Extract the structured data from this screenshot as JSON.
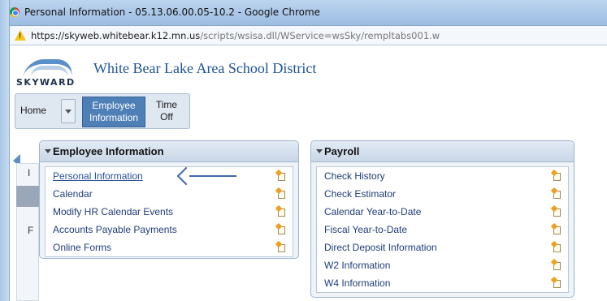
{
  "window": {
    "title": "Personal Information - 05.13.06.00.05-10.2 - Google Chrome"
  },
  "address_bar": {
    "url_host": "https://skyweb.whitebear.k12.mn.us",
    "url_path": "/scripts/wsisa.dll/WService=wsSky/rempltabs001.w"
  },
  "header": {
    "logo_text": "SKYWARD",
    "district_name": "White Bear Lake Area School District"
  },
  "nav": {
    "home": "Home",
    "employee_line1": "Employee",
    "employee_line2": "Information",
    "time_line1": "Time",
    "time_line2": "Off"
  },
  "sidebar": {
    "letter1": "I",
    "letter2": "F"
  },
  "employee_panel": {
    "title": "Employee Information",
    "items": [
      {
        "label": "Personal Information",
        "active": true
      },
      {
        "label": "Calendar"
      },
      {
        "label": "Modify HR Calendar Events"
      },
      {
        "label": "Accounts Payable Payments"
      },
      {
        "label": "Online Forms"
      }
    ]
  },
  "payroll_panel": {
    "title": "Payroll",
    "items": [
      {
        "label": "Check History"
      },
      {
        "label": "Check Estimator"
      },
      {
        "label": "Calendar Year-to-Date"
      },
      {
        "label": "Fiscal Year-to-Date"
      },
      {
        "label": "Direct Deposit Information"
      },
      {
        "label": "W2 Information"
      },
      {
        "label": "W4 Information"
      }
    ]
  },
  "colors": {
    "accent": "#4e7fb7",
    "link": "#1f3d7a",
    "annotation_arrow": "#3e6aa8"
  }
}
